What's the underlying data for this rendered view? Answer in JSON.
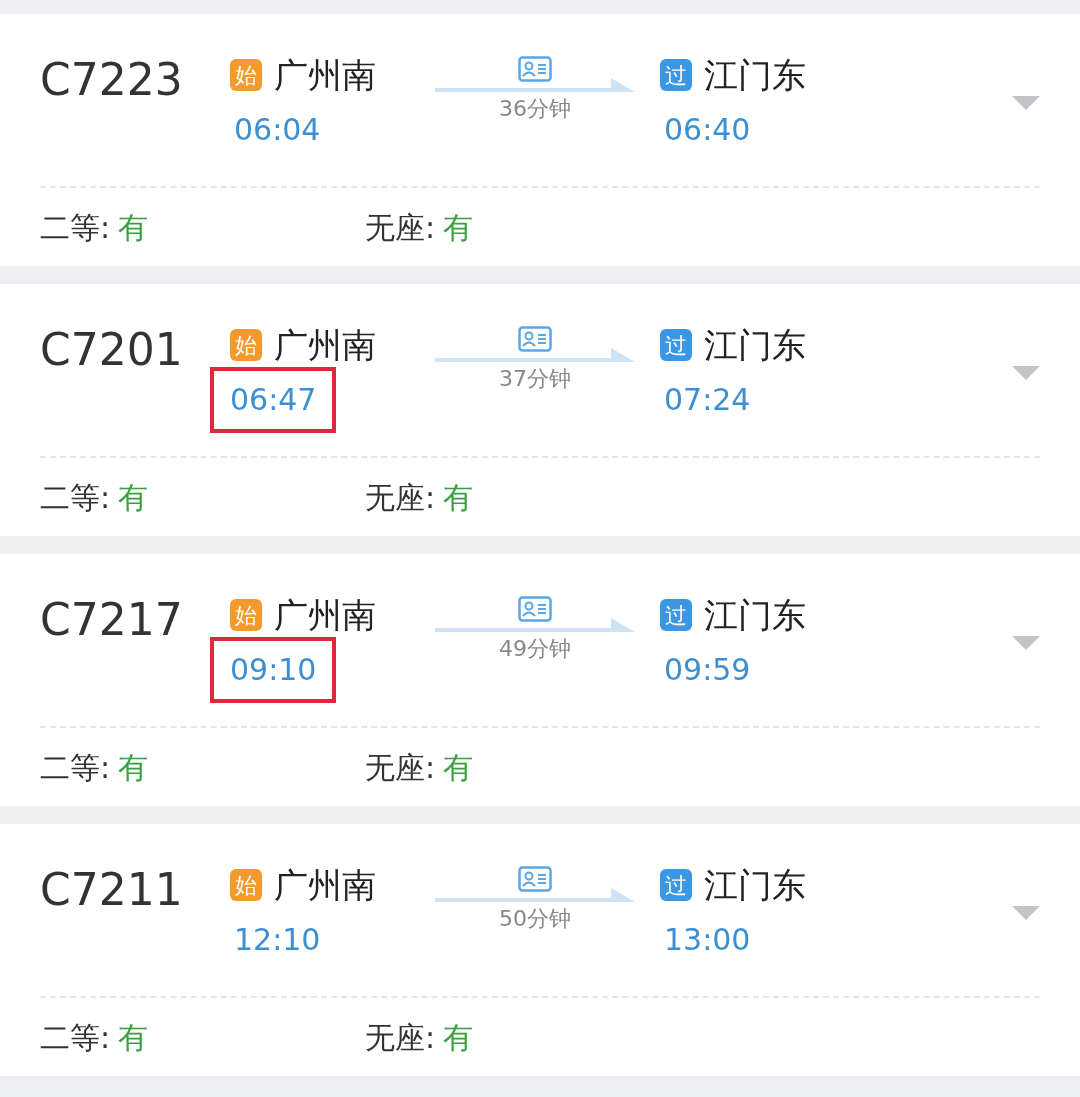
{
  "trains": [
    {
      "number": "C7223",
      "from": {
        "badge": "始",
        "color": "#f29a2e",
        "name": "广州南",
        "time": "06:04",
        "highlighted": false
      },
      "duration": "36分钟",
      "to": {
        "badge": "过",
        "color": "#3b97e3",
        "name": "江门东",
        "time": "06:40"
      },
      "seats": [
        {
          "label": "二等:",
          "value": "有"
        },
        {
          "label": "无座:",
          "value": "有"
        }
      ]
    },
    {
      "number": "C7201",
      "from": {
        "badge": "始",
        "color": "#f29a2e",
        "name": "广州南",
        "time": "06:47",
        "highlighted": true
      },
      "duration": "37分钟",
      "to": {
        "badge": "过",
        "color": "#3b97e3",
        "name": "江门东",
        "time": "07:24"
      },
      "seats": [
        {
          "label": "二等:",
          "value": "有"
        },
        {
          "label": "无座:",
          "value": "有"
        }
      ]
    },
    {
      "number": "C7217",
      "from": {
        "badge": "始",
        "color": "#f29a2e",
        "name": "广州南",
        "time": "09:10",
        "highlighted": true
      },
      "duration": "49分钟",
      "to": {
        "badge": "过",
        "color": "#3b97e3",
        "name": "江门东",
        "time": "09:59"
      },
      "seats": [
        {
          "label": "二等:",
          "value": "有"
        },
        {
          "label": "无座:",
          "value": "有"
        }
      ]
    },
    {
      "number": "C7211",
      "from": {
        "badge": "始",
        "color": "#f29a2e",
        "name": "广州南",
        "time": "12:10",
        "highlighted": false
      },
      "duration": "50分钟",
      "to": {
        "badge": "过",
        "color": "#3b97e3",
        "name": "江门东",
        "time": "13:00"
      },
      "seats": [
        {
          "label": "二等:",
          "value": "有"
        },
        {
          "label": "无座:",
          "value": "有"
        }
      ]
    }
  ]
}
